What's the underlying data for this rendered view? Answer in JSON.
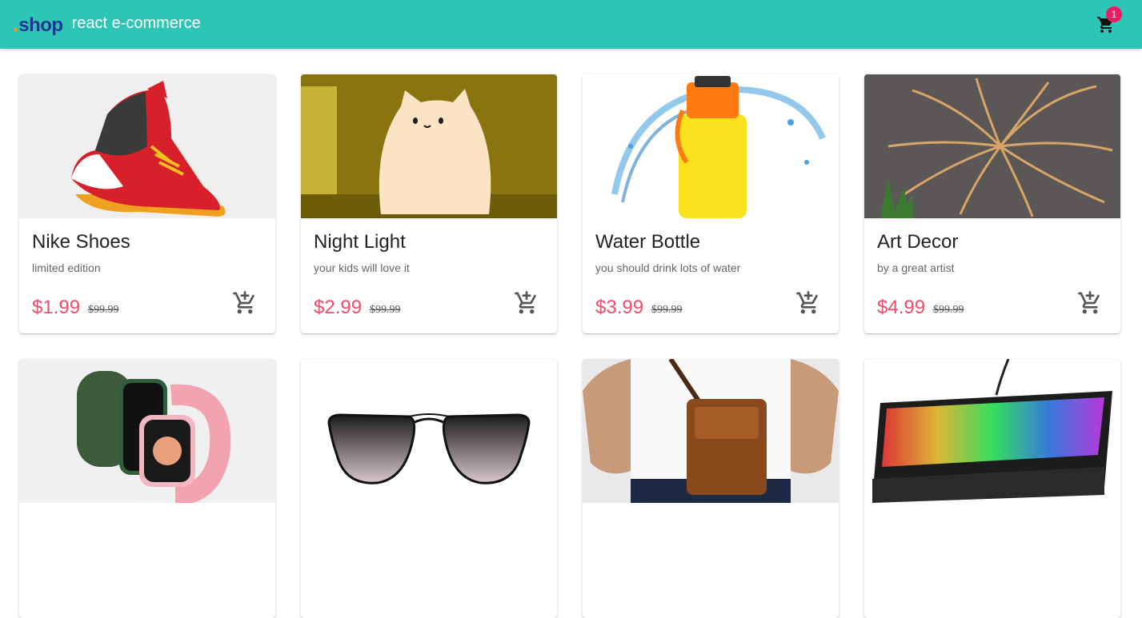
{
  "header": {
    "logo_dot": ".",
    "logo_text": "shop",
    "title": "react e-commerce",
    "cart_icon": "shopping-cart-icon",
    "cart_count": "1"
  },
  "colors": {
    "appbar": "#2ec4b6",
    "price": "#ef4b6c",
    "badge": "#e91e63",
    "logo_dot": "#ff9f1c",
    "logo_text": "#1b3a8f"
  },
  "products": [
    {
      "title": "Nike Shoes",
      "subtitle": "limited edition",
      "price": "$1.99",
      "old_price": "$99.99",
      "action_icon": "add-to-cart-icon"
    },
    {
      "title": "Night Light",
      "subtitle": "your kids will love it",
      "price": "$2.99",
      "old_price": "$99.99",
      "action_icon": "add-to-cart-icon"
    },
    {
      "title": "Water Bottle",
      "subtitle": "you should drink lots of water",
      "price": "$3.99",
      "old_price": "$99.99",
      "action_icon": "add-to-cart-icon"
    },
    {
      "title": "Art Decor",
      "subtitle": "by a great artist",
      "price": "$4.99",
      "old_price": "$99.99",
      "action_icon": "add-to-cart-icon"
    },
    {
      "title": "",
      "subtitle": "",
      "price": "",
      "old_price": ""
    },
    {
      "title": "",
      "subtitle": "",
      "price": "",
      "old_price": ""
    },
    {
      "title": "",
      "subtitle": "",
      "price": "",
      "old_price": ""
    },
    {
      "title": "",
      "subtitle": "",
      "price": "",
      "old_price": ""
    }
  ]
}
